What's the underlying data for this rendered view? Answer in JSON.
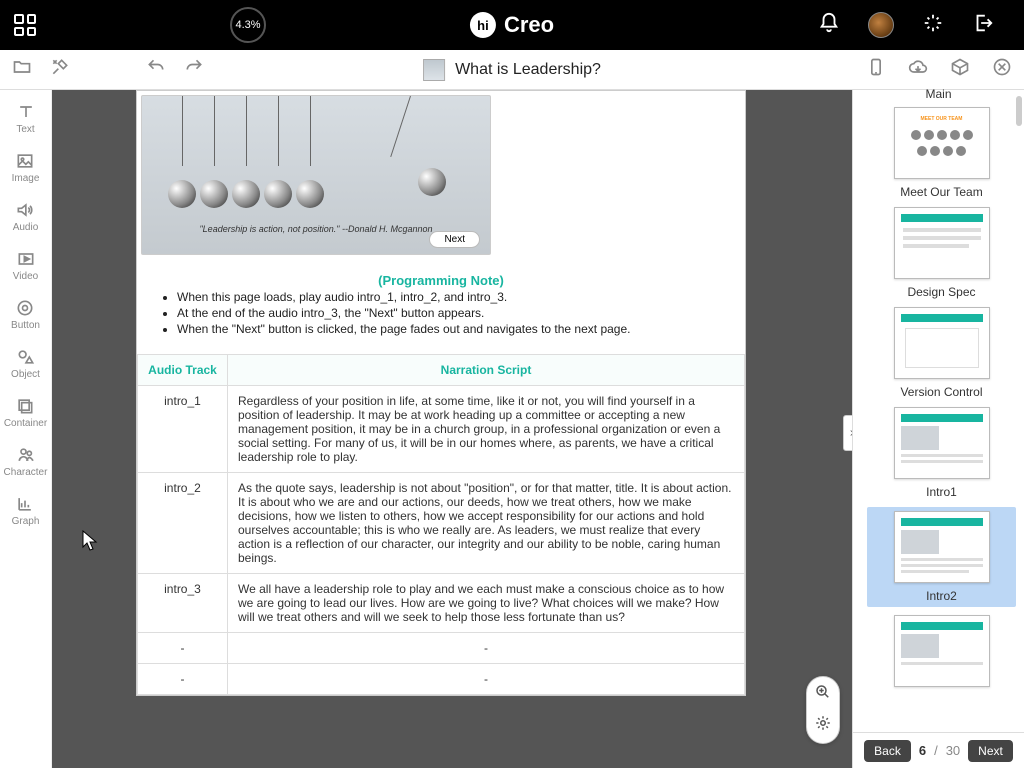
{
  "topbar": {
    "progress": "4.3%",
    "brand_hi": "hi",
    "brand_name": "Creo"
  },
  "docbar": {
    "title": "What is Leadership?"
  },
  "tools": {
    "text": "Text",
    "image": "Image",
    "audio": "Audio",
    "video": "Video",
    "button": "Button",
    "object": "Object",
    "container": "Container",
    "character": "Character",
    "graph": "Graph"
  },
  "slide": {
    "quote": "\"Leadership is action, not position.\"  --Donald H. Mcgannon",
    "next_label": "Next",
    "prog_note_heading": "(Programming Note)",
    "notes": [
      "When this page loads, play audio intro_1, intro_2, and intro_3.",
      "At the end of the audio intro_3, the \"Next\" button appears.",
      "When the \"Next\" button is clicked, the page fades out and navigates to the next page."
    ],
    "table": {
      "head_track": "Audio Track",
      "head_script": "Narration Script",
      "rows": [
        {
          "track": "intro_1",
          "script": "Regardless of your position in life, at some time, like it or not, you will find yourself in a position of leadership. It may be at work heading up a committee or accepting a new management position, it may be in a church group, in a professional organization or even a social setting. For many of us, it will be in our homes where, as parents, we have a critical leadership role to play."
        },
        {
          "track": "intro_2",
          "script": "As the quote says, leadership is not about \"position\", or for that matter, title. It is about action. It is about who we are and our actions, our deeds, how we treat others, how we make decisions, how we listen to others, how we accept responsibility for our actions and hold ourselves accountable; this is who we really are. As leaders, we must realize that every action is a reflection of our character, our integrity and our ability to be noble, caring human beings."
        },
        {
          "track": "intro_3",
          "script": "We all have a leadership role to play and we each must make a conscious choice as to how we are going to lead our lives. How are we going to live? What choices will we make? How will we treat others and will we seek to help those less fortunate than us?"
        },
        {
          "track": "-",
          "script": "-"
        },
        {
          "track": "-",
          "script": "-"
        }
      ]
    }
  },
  "panel": {
    "header_cut": "Main",
    "thumbs": [
      "Meet Our Team",
      "Design Spec",
      "Version Control",
      "Intro1",
      "Intro2"
    ],
    "selected_index": 4,
    "footer": {
      "back": "Back",
      "current": "6",
      "sep": " / ",
      "total": "30",
      "next": "Next"
    }
  }
}
